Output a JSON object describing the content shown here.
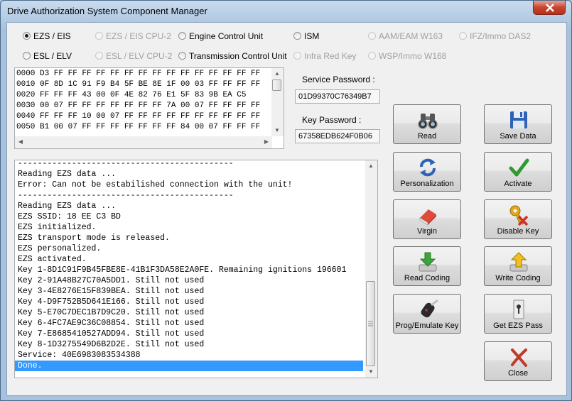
{
  "window": {
    "title": "Drive Authorization System Component Manager"
  },
  "radios": [
    {
      "label": "EZS / EIS",
      "checked": true,
      "disabled": false
    },
    {
      "label": "EZS / EIS CPU-2",
      "checked": false,
      "disabled": true
    },
    {
      "label": "Engine Control Unit",
      "checked": false,
      "disabled": false
    },
    {
      "label": "ISM",
      "checked": false,
      "disabled": false
    },
    {
      "label": "AAM/EAM W163",
      "checked": false,
      "disabled": true
    },
    {
      "label": "IFZ/Immo DAS2",
      "checked": false,
      "disabled": true
    },
    {
      "label": "ESL / ELV",
      "checked": false,
      "disabled": false
    },
    {
      "label": "ESL / ELV CPU-2",
      "checked": false,
      "disabled": true
    },
    {
      "label": "Transmission Control Unit",
      "checked": false,
      "disabled": false
    },
    {
      "label": "Infra Red Key",
      "checked": false,
      "disabled": true
    },
    {
      "label": "WSP/Immo W168",
      "checked": false,
      "disabled": true
    }
  ],
  "hex_dump": [
    "0000 D3 FF FF FF FF FF FF FF FF FF FF FF FF FF FF FF",
    "0010 0F 8D 1C 91 F9 B4 5F BE 8E 1F 00 03 FF FF FF FF",
    "0020 FF FF FF 43 00 0F 4E 82 76 E1 5F 83 9B EA C5",
    "0030 00 07 FF FF FF FF FF FF FF 7A 00 07 FF FF FF FF",
    "0040 FF FF FF 10 00 07 FF FF FF FF FF FF FF FF FF FF",
    "0050 B1 00 07 FF FF FF FF FF FF FF 84 00 07 FF FF FF"
  ],
  "service_password": {
    "label": "Service Password :",
    "value": "01D99370C76349B7"
  },
  "key_password": {
    "label": "Key Password :",
    "value": "67358EDB624F0B06"
  },
  "log": [
    "--------------------------------------------",
    "Reading EZS data ...",
    "Error: Can not be estabilished connection with the unit!",
    "--------------------------------------------",
    "Reading EZS data ...",
    "EZS SSID: 18 EE C3 BD",
    "EZS initialized.",
    "EZS transport mode is released.",
    "EZS personalized.",
    "EZS activated.",
    "Key 1-8D1C91F9B45FBE8E-41B1F3DA58E2A0FE. Remaining ignitions 196601",
    "Key 2-91A48B27C70A5DD1. Still not used",
    "Key 3-4E8276E15F839BEA. Still not used",
    "Key 4-D9F752B5D641E166. Still not used",
    "Key 5-E70C7DEC1B7D9C20. Still not used",
    "Key 6-4FC7AE9C36C08854. Still not used",
    "Key 7-E8685410527ADD94. Still not used",
    "Key 8-1D3275549D6B2D2E. Still not used",
    "Service: 40E6983083534388",
    "Done."
  ],
  "buttons": {
    "read": {
      "label": "Read",
      "icon": "binoculars-icon"
    },
    "save_data": {
      "label": "Save Data",
      "icon": "floppy-disk-icon"
    },
    "personalization": {
      "label": "Personalization",
      "icon": "refresh-arrows-icon"
    },
    "activate": {
      "label": "Activate",
      "icon": "checkmark-icon"
    },
    "virgin": {
      "label": "Virgin",
      "icon": "eraser-icon"
    },
    "disable_key": {
      "label": "Disable Key",
      "icon": "key-disable-icon"
    },
    "read_coding": {
      "label": "Read Coding",
      "icon": "download-arrow-icon"
    },
    "write_coding": {
      "label": "Write Coding",
      "icon": "upload-arrow-icon"
    },
    "prog_emulate_key": {
      "label": "Prog/Emulate Key",
      "icon": "car-key-icon"
    },
    "get_ezs_pass": {
      "label": "Get EZS Pass",
      "icon": "lock-slot-icon"
    },
    "close": {
      "label": "Close",
      "icon": "red-x-icon"
    }
  },
  "colors": {
    "selection": "#3399ff",
    "title_close": "#c7452f",
    "activate_check": "#2f9a2f",
    "close_x": "#c0392b"
  }
}
